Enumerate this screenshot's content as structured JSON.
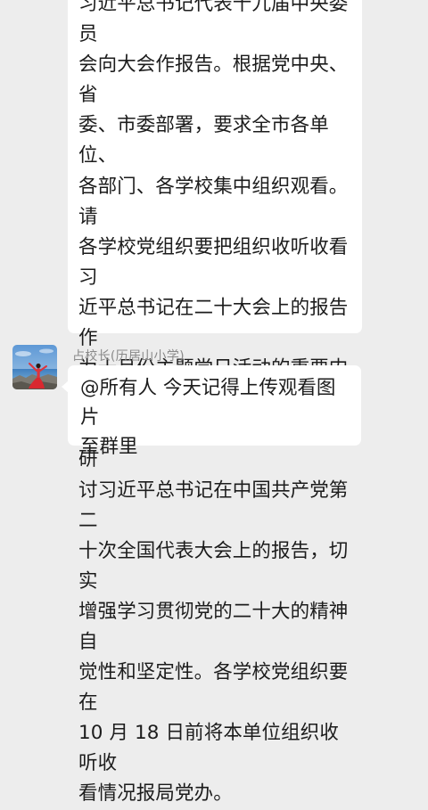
{
  "messages": [
    {
      "text": "习近平总书记代表十九届中央委员\n会向大会作报告。根据党中央、省\n委、市委部署，要求全市各单位、\n各部门、各学校集中组织观看。请\n各学校党组织要把组织收听收看习\n近平总书记在二十大会上的报告作\n为十月份主题党日活动的重要内容，\n组织广大党员干部第一时间学习研\n讨习近平总书记在中国共产党第二\n十次全国代表大会上的报告，切实\n增强学习贯彻党的二十大的精神自\n觉性和坚定性。各学校党组织要在\n10 月 18 日前将本单位组织收听收\n看情况报局党办。"
    },
    {
      "sender": "占校长(历居山小学)",
      "avatar_icon": "user-photo-avatar",
      "text": "@所有人   今天记得上传观看图片\n至群里"
    }
  ],
  "colors": {
    "background": "#ededed",
    "bubble": "#ffffff",
    "sender_name": "#8a8a8a",
    "message_text": "#1c1c1c"
  }
}
